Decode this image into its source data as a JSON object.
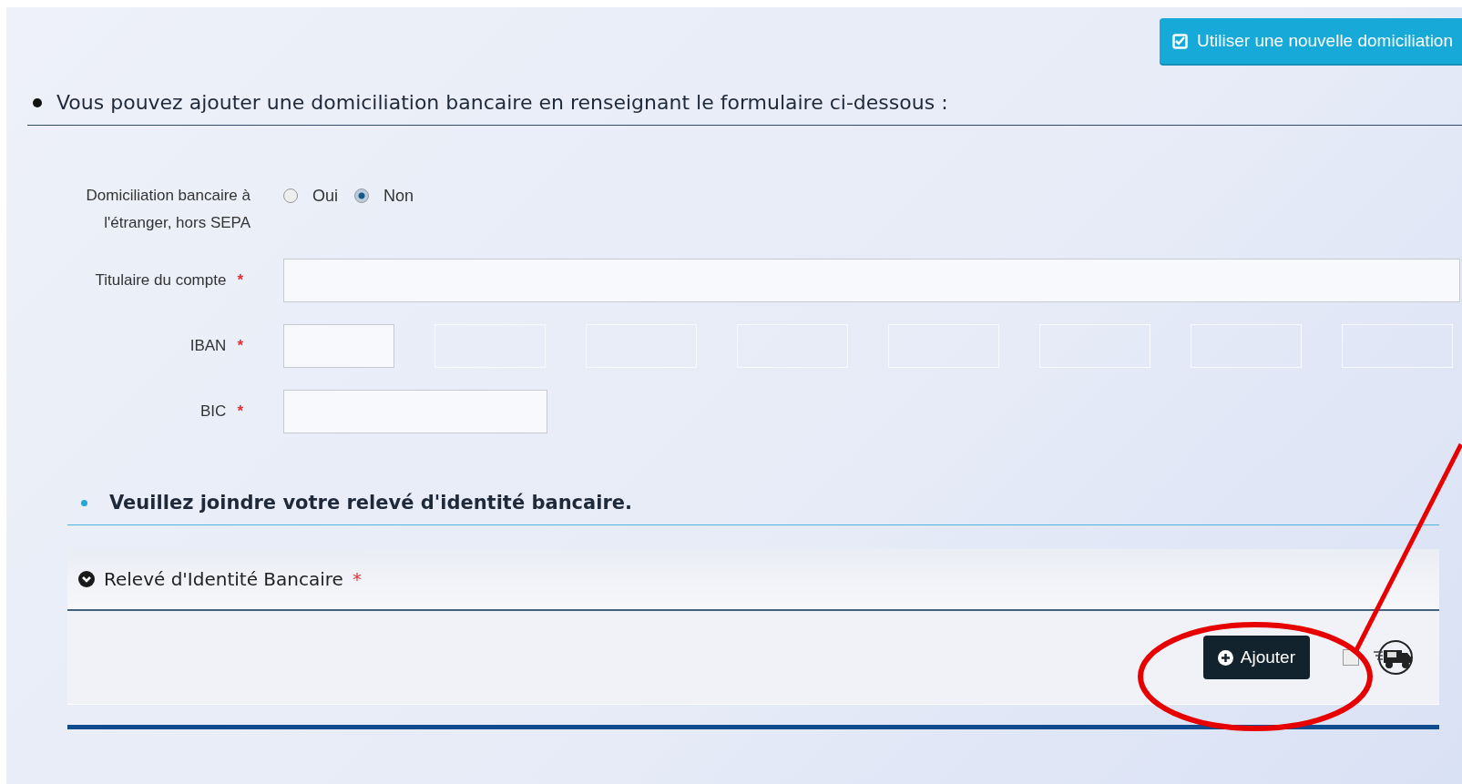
{
  "top_button": {
    "label": "Utiliser une nouvelle domiciliation"
  },
  "intro": "Vous pouvez ajouter une domiciliation bancaire en renseignant le formulaire ci-dessous :",
  "form": {
    "abroad": {
      "label": "Domiciliation bancaire à l'étranger, hors SEPA",
      "options": [
        {
          "label": "Oui",
          "selected": false
        },
        {
          "label": "Non",
          "selected": true
        }
      ]
    },
    "holder": {
      "label": "Titulaire du compte",
      "required": "*"
    },
    "iban": {
      "label": "IBAN",
      "required": "*",
      "fields": [
        {
          "disabled": false
        },
        {
          "disabled": true
        },
        {
          "disabled": true
        },
        {
          "disabled": true
        },
        {
          "disabled": true
        },
        {
          "disabled": true
        },
        {
          "disabled": true
        },
        {
          "disabled": true
        }
      ]
    },
    "bic": {
      "label": "BIC",
      "required": "*"
    }
  },
  "attach_heading": "Veuillez joindre votre relevé d'identité bancaire.",
  "panel": {
    "title": "Relevé d'Identité Bancaire",
    "required": "*",
    "expanded": true,
    "add_button": "Ajouter",
    "checked": false
  },
  "annotation": {
    "kind": "ellipse"
  }
}
